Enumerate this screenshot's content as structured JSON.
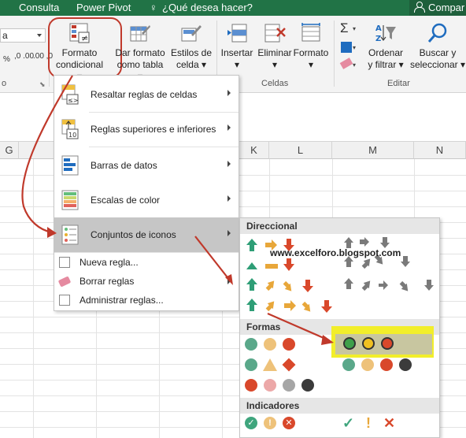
{
  "topbar": {
    "tabs": [
      "Consulta",
      "Power Pivot"
    ],
    "tell_me": "¿Qué desea hacer?",
    "share": "Compar"
  },
  "ribbon": {
    "name_box": "a",
    "format_buttons": [
      ",0 .00",
      ".00 ,0"
    ],
    "conditional_format": {
      "line1": "Formato",
      "line2": "condicional"
    },
    "format_as_table": {
      "line1": "Dar formato",
      "line2": "como tabla"
    },
    "cell_styles": {
      "line1": "Estilos de",
      "line2": "celda"
    },
    "insert": "Insertar",
    "delete": "Eliminar",
    "format": "Formato",
    "sort_filter": {
      "line1": "Ordenar",
      "line2": "y filtrar"
    },
    "find_select": {
      "line1": "Buscar y",
      "line2": "seleccionar"
    },
    "group_labels": {
      "number": "o",
      "cells": "Celdas",
      "editing": "Editar"
    }
  },
  "columns": [
    "G",
    "K",
    "L",
    "M",
    "N"
  ],
  "menu": {
    "items": [
      {
        "label": "Resaltar reglas de celdas",
        "icon": "highlight-rules-icon"
      },
      {
        "label": "Reglas superiores e inferiores",
        "icon": "top-bottom-icon"
      },
      {
        "label": "Barras de datos",
        "icon": "data-bars-icon"
      },
      {
        "label": "Escalas de color",
        "icon": "color-scales-icon"
      },
      {
        "label": "Conjuntos de iconos",
        "icon": "icon-sets-icon"
      }
    ],
    "small_items": [
      "Nueva regla...",
      "Borrar reglas",
      "Administrar reglas..."
    ]
  },
  "submenu": {
    "sections": [
      "Direccional",
      "Formas",
      "Indicadores"
    ]
  },
  "watermark": "www.excelforo.blogspot.com",
  "colors": {
    "excel_green": "#217346",
    "arrow_red": "#c0392b",
    "highlight_yellow": "#f2ee2a"
  }
}
